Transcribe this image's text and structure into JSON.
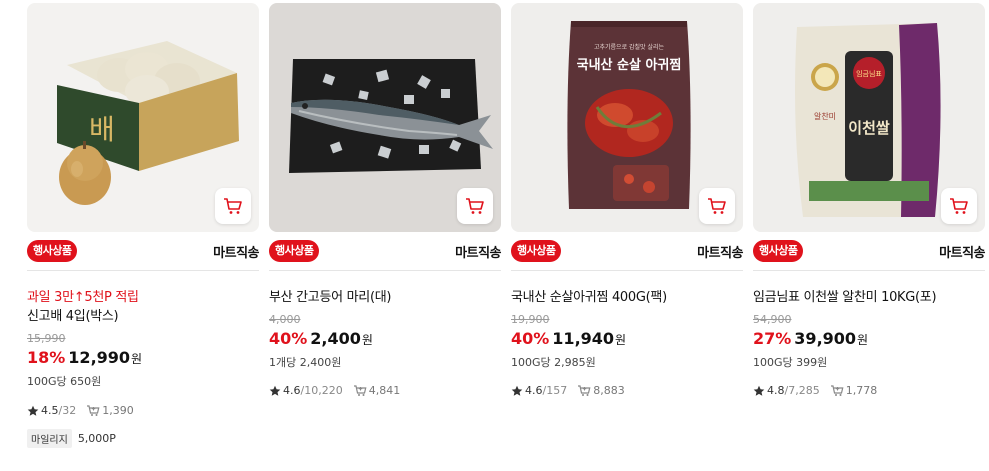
{
  "colors": {
    "accent": "#e0121c",
    "text": "#111111",
    "muted": "#999999"
  },
  "products": [
    {
      "event_badge": "행사상품",
      "shipping": "마트직송",
      "promo": "과일 3만↑5천P 적립",
      "name": "신고배 4입(박스)",
      "original_price": "15,990",
      "discount_rate": "18%",
      "price": "12,990",
      "currency": "원",
      "unit_price": "100G당 650원",
      "rating": "4.5",
      "reviews": "/32",
      "cart_count": "1,390",
      "mileage_label": "마일리지",
      "mileage_value": "5,000P",
      "icon": "pear-box-image"
    },
    {
      "event_badge": "행사상품",
      "shipping": "마트직송",
      "name": "부산 간고등어 마리(대)",
      "original_price": "4,000",
      "discount_rate": "40%",
      "price": "2,400",
      "currency": "원",
      "unit_price": "1개당 2,400원",
      "rating": "4.6",
      "reviews": "/10,220",
      "cart_count": "4,841",
      "icon": "mackerel-image"
    },
    {
      "event_badge": "행사상품",
      "shipping": "마트직송",
      "name": "국내산 순살아귀찜 400G(팩)",
      "original_price": "19,900",
      "discount_rate": "40%",
      "price": "11,940",
      "currency": "원",
      "unit_price": "100G당 2,985원",
      "rating": "4.6",
      "reviews": "/157",
      "cart_count": "8,883",
      "package_text": "국내산 순살 아귀찜",
      "package_subtext": "고추기름으로 감칠맛 살리는",
      "icon": "monkfish-pack-image"
    },
    {
      "event_badge": "행사상품",
      "shipping": "마트직송",
      "name": "임금님표 이천쌀 알찬미 10KG(포)",
      "original_price": "54,900",
      "discount_rate": "27%",
      "price": "39,900",
      "currency": "원",
      "unit_price": "100G당 399원",
      "rating": "4.8",
      "reviews": "/7,285",
      "cart_count": "1,778",
      "package_text": "이천쌀",
      "package_subtext": "임금님표",
      "package_sub2": "알찬미",
      "icon": "rice-bag-image"
    }
  ]
}
